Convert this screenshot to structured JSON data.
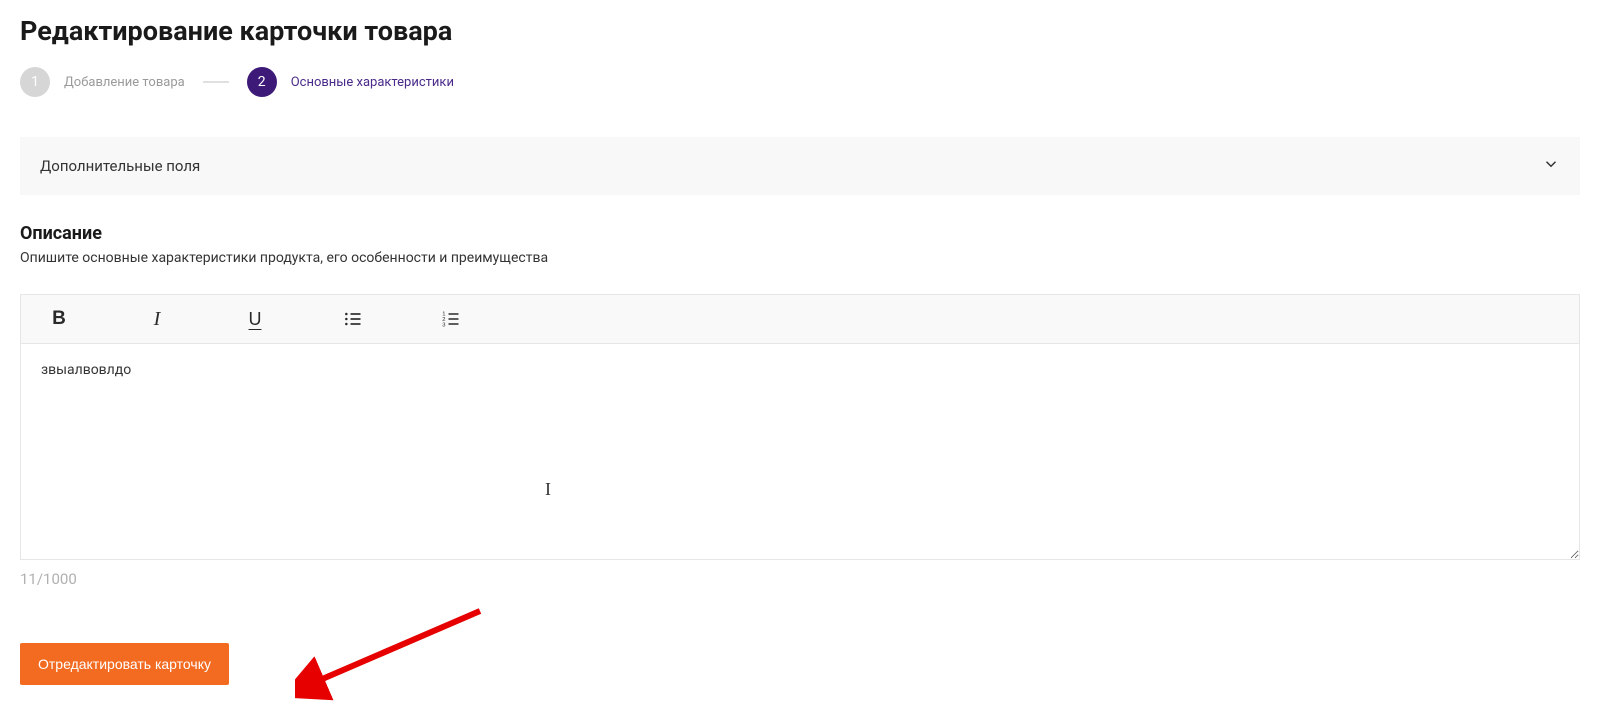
{
  "page": {
    "title": "Редактирование карточки товара"
  },
  "stepper": {
    "steps": [
      {
        "num": "1",
        "label": "Добавление товара",
        "state": "inactive"
      },
      {
        "num": "2",
        "label": "Основные характеристики",
        "state": "active"
      }
    ]
  },
  "accordion": {
    "label": "Дополнительные поля"
  },
  "description": {
    "title": "Описание",
    "hint": "Опишите основные характеристики продукта, его особенности и преимущества",
    "content": "звыалвовлдо",
    "char_count": "11/1000"
  },
  "toolbar": {
    "bold": "B",
    "italic": "I",
    "underline": "U"
  },
  "actions": {
    "submit_label": "Отредактировать карточку"
  }
}
